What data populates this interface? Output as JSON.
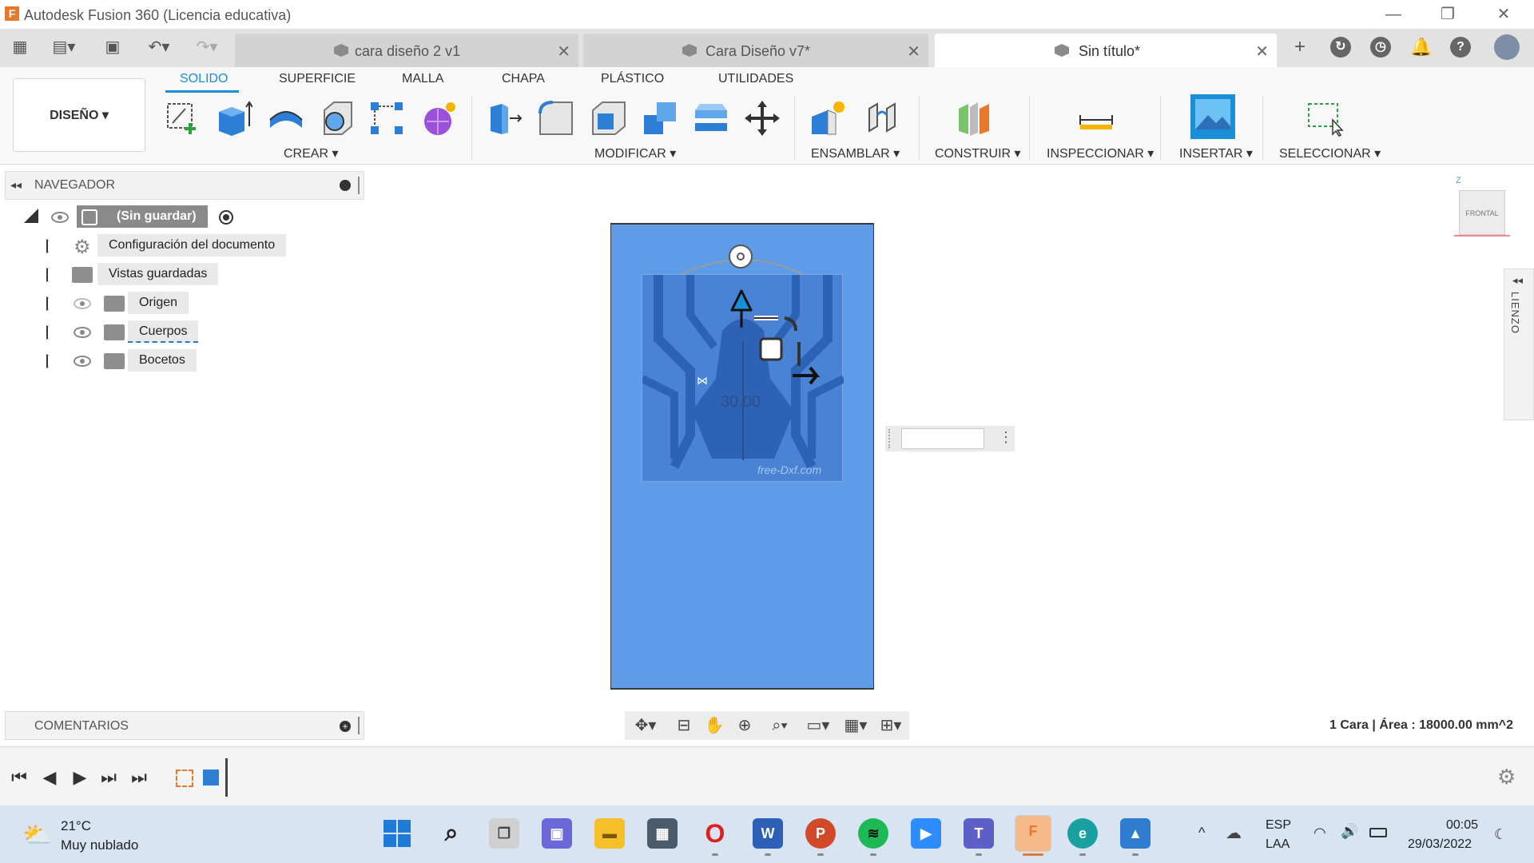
{
  "window": {
    "title": "Autodesk Fusion 360 (Licencia educativa)",
    "logo_letter": "F"
  },
  "tabs": [
    {
      "label": "cara diseño 2 v1",
      "active": false
    },
    {
      "label": "Cara Diseño v7*",
      "active": false
    },
    {
      "label": "Sin título*",
      "active": true
    }
  ],
  "toolbar": {
    "workspace": "DISEÑO ▾",
    "ribbon_tabs": [
      "SOLIDO",
      "SUPERFICIE",
      "MALLA",
      "CHAPA",
      "PLÁSTICO",
      "UTILIDADES"
    ],
    "groups": [
      "CREAR ▾",
      "MODIFICAR ▾",
      "ENSAMBLAR ▾",
      "CONSTRUIR ▾",
      "INSPECCIONAR ▾",
      "INSERTAR ▾",
      "SELECCIONAR ▾"
    ]
  },
  "browser": {
    "title": "NAVEGADOR",
    "root": "(Sin guardar)",
    "items": [
      "Configuración del documento",
      "Vistas guardadas",
      "Origen",
      "Cuerpos",
      "Bocetos"
    ]
  },
  "comments": {
    "title": "COMENTARIOS"
  },
  "viewport": {
    "dimension_text": "30.00",
    "watermark": "free-Dxf.com",
    "viewcube_label": "FRONTAL",
    "canvas_panel": "LIENZO"
  },
  "status_text": "1 Cara | Área : 18000.00 mm^2",
  "taskbar": {
    "temperature": "21°C",
    "weather": "Muy nublado",
    "lang1": "ESP",
    "lang2": "LAA",
    "time": "00:05",
    "date": "29/03/2022"
  },
  "colors": {
    "accent": "#1a8fd8",
    "plate": "#5e9ce8",
    "sketch": "#4a82d4"
  }
}
